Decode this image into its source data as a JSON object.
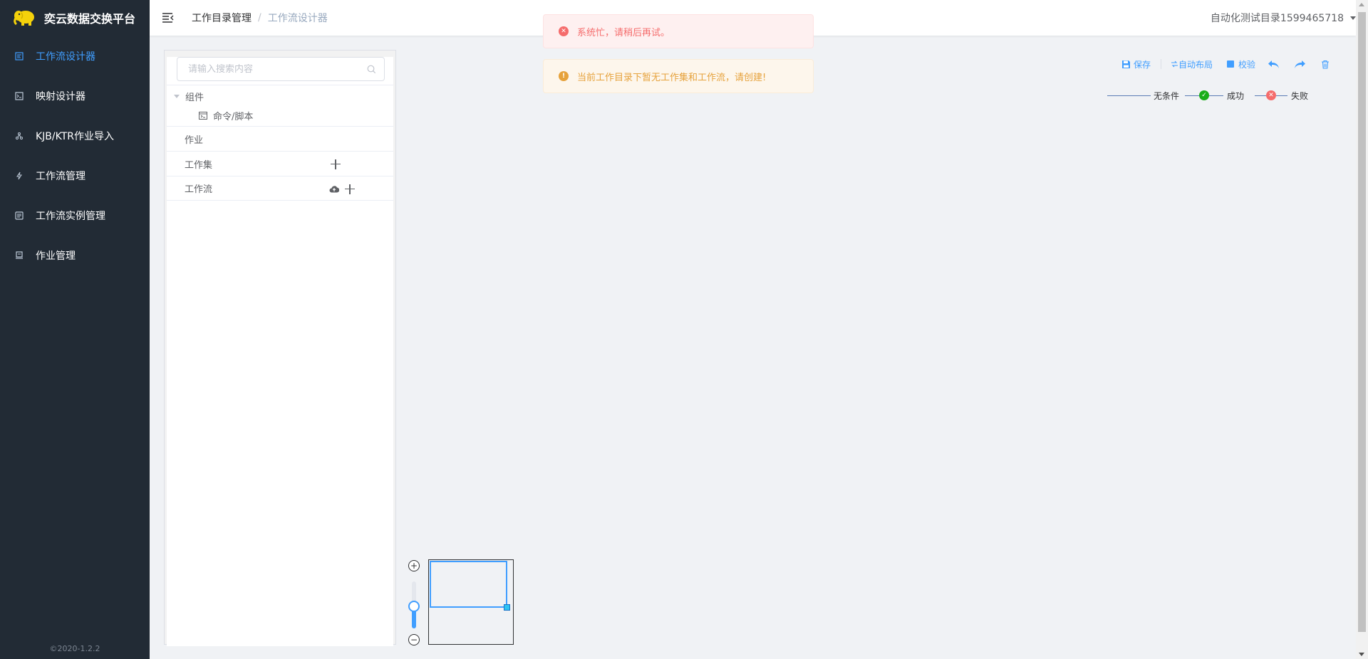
{
  "app": {
    "title": "奕云数据交换平台",
    "version": "©2020-1.2.2"
  },
  "sidebar": {
    "items": [
      {
        "label": "工作流设计器",
        "icon": "designer-icon",
        "active": true
      },
      {
        "label": "映射设计器",
        "icon": "mapping-icon",
        "active": false
      },
      {
        "label": "KJB/KTR作业导入",
        "icon": "import-icon",
        "active": false
      },
      {
        "label": "工作流管理",
        "icon": "workflow-icon",
        "active": false
      },
      {
        "label": "工作流实例管理",
        "icon": "instance-icon",
        "active": false
      },
      {
        "label": "作业管理",
        "icon": "job-icon",
        "active": false
      }
    ]
  },
  "header": {
    "breadcrumb": [
      "工作目录管理",
      "工作流设计器"
    ],
    "breadcrumb_separator": "/",
    "user_directory": "自动化测试目录1599465718"
  },
  "tree": {
    "search_placeholder": "请输入搜索内容",
    "components_label": "组件",
    "component_child": "命令/脚本",
    "groups": [
      {
        "label": "作业",
        "has_add": false,
        "has_upload": false
      },
      {
        "label": "工作集",
        "has_add": true,
        "has_upload": false
      },
      {
        "label": "工作流",
        "has_add": true,
        "has_upload": true
      }
    ]
  },
  "messages": {
    "error": "系统忙，请稍后再试。",
    "warning": "当前工作目录下暂无工作集和工作流，请创建!"
  },
  "toolbar": {
    "save": "保存",
    "auto_layout": "自动布局",
    "validate": "校验"
  },
  "legend": {
    "unconditional": "无条件",
    "success": "成功",
    "failure": "失败"
  },
  "colors": {
    "sidebar_bg": "#222b35",
    "accent": "#409eff",
    "error": "#f56c6c",
    "warning": "#e6a23c",
    "success": "#1aad19"
  }
}
